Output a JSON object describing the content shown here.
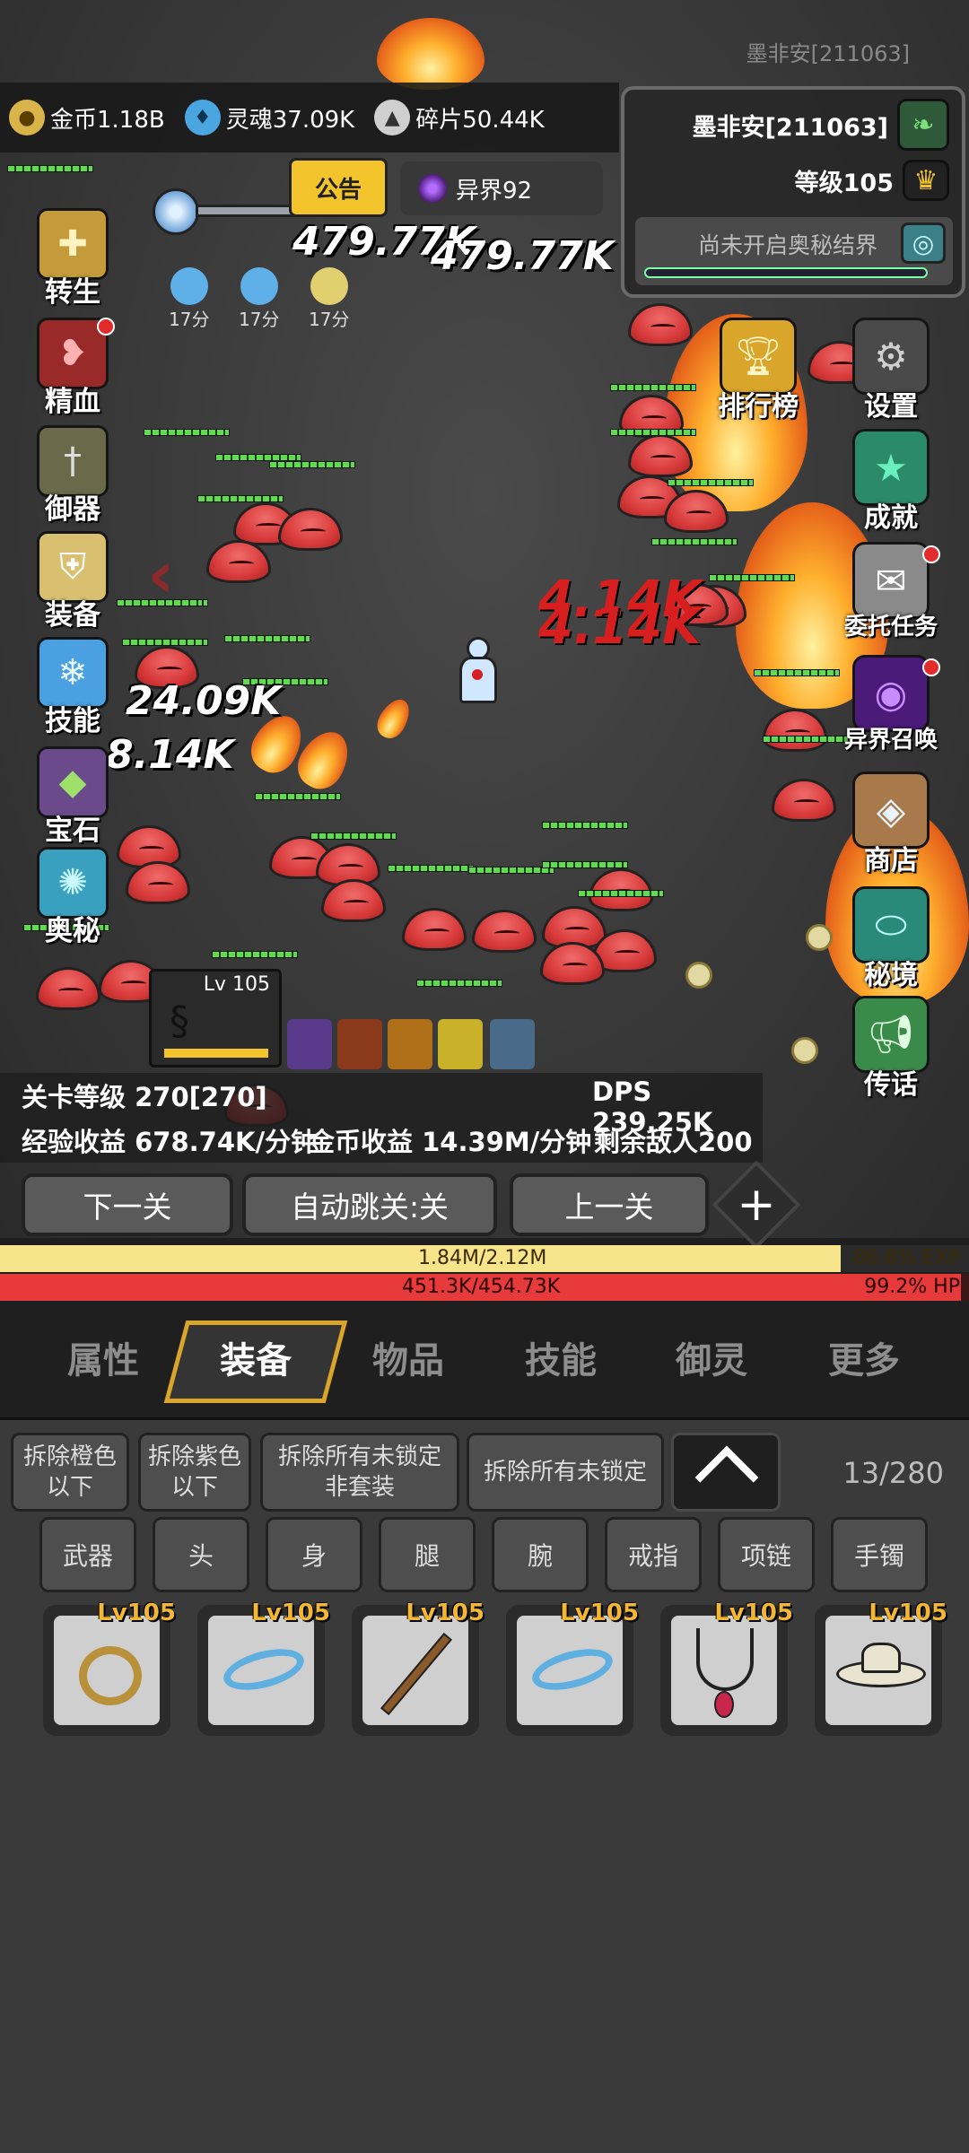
{
  "header": {
    "player_watermark": "墨非安[211063]"
  },
  "currency": [
    {
      "icon": "gold-coin-icon",
      "label": "金币1.18B"
    },
    {
      "icon": "soul-flame-icon",
      "label": "灵魂37.09K"
    },
    {
      "icon": "fragment-icon",
      "label": "碎片50.44K"
    }
  ],
  "player": {
    "name": "墨非安[211063]",
    "level": "等级105",
    "realm_status": "尚未开启奥秘结界"
  },
  "notice_label": "公告",
  "otherworld_label": "异界92",
  "buffs": [
    "17分",
    "17分",
    "17分"
  ],
  "left_menu": [
    "转生",
    "精血",
    "御器",
    "装备",
    "技能",
    "宝石",
    "奥秘"
  ],
  "right_menu": [
    "排行榜",
    "设置",
    "成就",
    "委托任务",
    "异界召唤",
    "商店",
    "秘境",
    "传话"
  ],
  "damage_numbers": [
    "479.77K",
    "479.77K",
    "4.14K",
    "4.14K",
    "24.09K",
    "8.14K"
  ],
  "pet": {
    "level": "Lv 105"
  },
  "stage": {
    "level": "关卡等级 270[270]",
    "dps": "DPS 239.25K",
    "exp_rate": "经验收益 678.74K/分钟",
    "gold_rate": "金币收益 14.39M/分钟",
    "enemies_left": "剩余敌人200"
  },
  "controls": {
    "next": "下一关",
    "auto": "自动跳关:关",
    "prev": "上一关"
  },
  "exp": {
    "text": "1.84M/2.12M",
    "percent": "86.8% EXP",
    "fraction": 0.868
  },
  "hp": {
    "text": "451.3K/454.73K",
    "percent": "99.2%   HP",
    "fraction": 0.992
  },
  "tabs": [
    "属性",
    "装备",
    "物品",
    "技能",
    "御灵",
    "更多"
  ],
  "active_tab": "装备",
  "dismantle_buttons": [
    "拆除橙色\n以下",
    "拆除紫色\n以下",
    "拆除所有未锁定\n非套装",
    "拆除所有未锁定"
  ],
  "inventory_count": "13/280",
  "slot_filters": [
    "武器",
    "头",
    "身",
    "腿",
    "腕",
    "戒指",
    "项链",
    "手镯"
  ],
  "items": [
    {
      "level": "Lv105",
      "icon": "ring-icon"
    },
    {
      "level": "Lv105",
      "icon": "bracelet-icon"
    },
    {
      "level": "Lv105",
      "icon": "staff-icon"
    },
    {
      "level": "Lv105",
      "icon": "bracelet-icon"
    },
    {
      "level": "Lv105",
      "icon": "necklace-icon"
    },
    {
      "level": "Lv105",
      "icon": "hat-icon"
    }
  ],
  "colors": {
    "accent_gold": "#d9a52a",
    "exp": "#f8e48a",
    "hp": "#e73a3a"
  }
}
